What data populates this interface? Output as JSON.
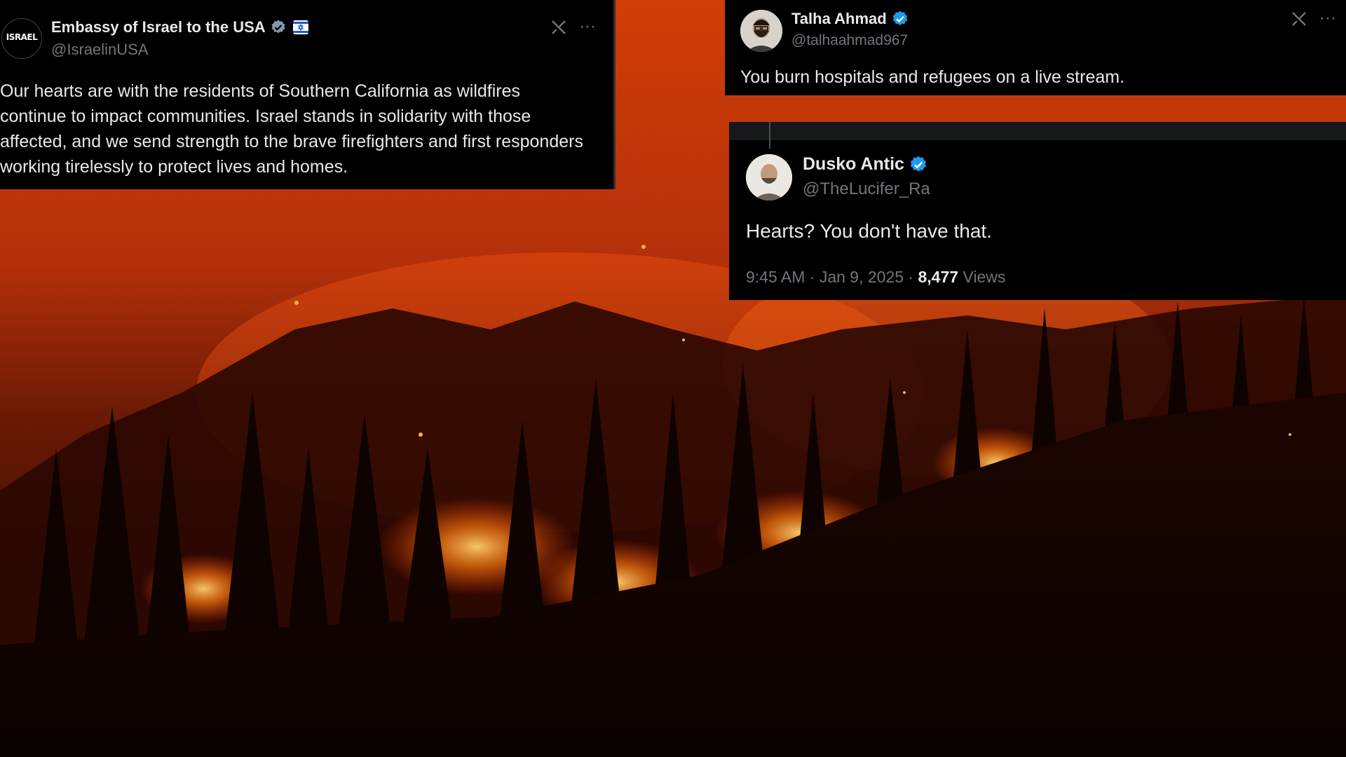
{
  "colors": {
    "card_bg": "#000000",
    "text": "#e7e9ea",
    "muted": "#71767b",
    "verified_blue": "#1d9bf0",
    "verified_gray": "#829aab",
    "fire_orange": "#ff5a0a"
  },
  "tweets": [
    {
      "avatar_text": "ISRAEL",
      "author": "Embassy of Israel to the USA",
      "handle": "@IsraelinUSA",
      "verified": "gray-verified-icon",
      "affiliate_badge": "israel-flag-badge-icon",
      "text": "Our hearts are with the residents of Southern California as wildfires continue to impact communities. Israel stands in solidarity with those affected, and we send strength to the brave firefighters and first responders working tirelessly to protect lives and homes.",
      "icons": [
        "grok-icon",
        "more-icon"
      ]
    },
    {
      "author": "Talha Ahmad",
      "handle": "@talhaahmad967",
      "verified": "blue-verified-icon",
      "text": "You burn hospitals and refugees on a live stream.",
      "icons": [
        "grok-icon",
        "more-icon"
      ]
    },
    {
      "author": "Dusko Antic",
      "handle": "@TheLucifer_Ra",
      "verified": "blue-verified-icon",
      "text": "Hearts? You don't have that.",
      "time": "9:45 AM · Jan 9, 2025 · ",
      "views": "8,477",
      "views_label": " Views"
    }
  ]
}
